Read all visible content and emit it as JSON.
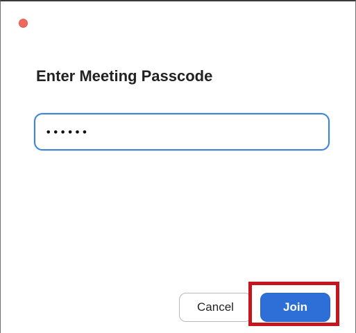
{
  "dialog": {
    "title": "Enter Meeting Passcode",
    "passcode_value": "••••••",
    "cancel_label": "Cancel",
    "join_label": "Join"
  },
  "colors": {
    "close_light": "#ee6a5f",
    "field_border": "#3e82d6",
    "join_button": "#2d6fd6",
    "highlight": "#c4161c"
  },
  "icons": {
    "close": "close-traffic-light-icon"
  }
}
